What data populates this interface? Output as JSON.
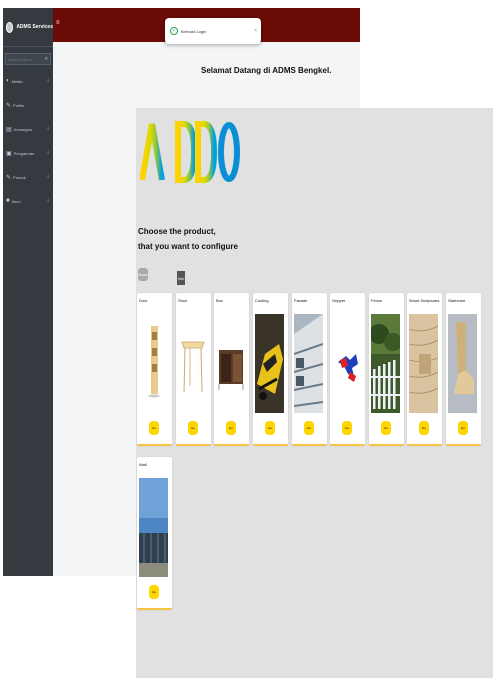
{
  "admin": {
    "brand": "ADMS Services",
    "search_placeholder": "Search Menu",
    "nav": [
      {
        "label": "Media",
        "icon": "gauge-icon"
      },
      {
        "label": "Profile",
        "icon": "user-icon"
      },
      {
        "label": "Keuangan",
        "icon": "chart-icon"
      },
      {
        "label": "Pengaturan",
        "icon": "cog-icon"
      },
      {
        "label": "Produk",
        "icon": "box-icon"
      },
      {
        "label": "Akun",
        "icon": "account-icon"
      }
    ],
    "toast_text": "Berhasil Login",
    "welcome": "Selamat Datang di ADMS Bengkel.",
    "topbar_color": "#6b0b06",
    "sidebar_color": "#343a40"
  },
  "configurator": {
    "logo_text": "AIDDDO",
    "choose_line1": "Choose the product,",
    "choose_line2": "that you want to configure",
    "back_label": "Back",
    "tooltip": "Info",
    "accent": "#ffd500",
    "products": [
      {
        "name": "Door",
        "button": "Go",
        "icon": "door-icon"
      },
      {
        "name": "Stool",
        "button": "Go",
        "icon": "table-icon"
      },
      {
        "name": "Box",
        "button": "Go",
        "icon": "cabinet-icon"
      },
      {
        "name": "Cooling",
        "button": "Go",
        "icon": "car-icon"
      },
      {
        "name": "Facade",
        "button": "Go",
        "icon": "building-icon"
      },
      {
        "name": "Gripper",
        "button": "Go",
        "icon": "gripper-icon"
      },
      {
        "name": "Fence",
        "button": "Go",
        "icon": "fence-icon"
      },
      {
        "name": "Wood Sculptures",
        "button": "Go",
        "icon": "wood-icon"
      },
      {
        "name": "Starhome",
        "button": "Go",
        "icon": "stair-icon"
      },
      {
        "name": "Wall",
        "button": "Go",
        "icon": "wall-icon"
      }
    ]
  }
}
